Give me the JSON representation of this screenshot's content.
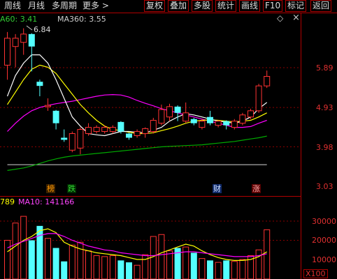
{
  "toolbar": {
    "left_tabs": [
      "周线",
      "月线",
      "多周期",
      "更多 >"
    ],
    "right_tabs": [
      "复权",
      "叠加",
      "多股",
      "统计",
      "画线",
      "F10",
      "标记",
      "返回"
    ]
  },
  "main_legend": {
    "ma60": "A60: 3.41",
    "ma360": "MA360: 3.55",
    "diamond_icon": "diamond-icon",
    "close_icon": "close-x-icon"
  },
  "volume_legend": {
    "vol": "789",
    "ma10": "MA10: 141166"
  },
  "price_axis": [
    "5.89",
    "4.93",
    "3.98",
    "3.03"
  ],
  "volume_axis": [
    "30000",
    "20000",
    "10000"
  ],
  "volume_unit": "X100",
  "peak_label": "6.84",
  "event_tags": [
    {
      "text": "榜",
      "color": "#ff9900",
      "bg": "#3a2000"
    },
    {
      "text": "跌",
      "color": "#33dd33",
      "bg": "#002a00"
    },
    {
      "text": "财",
      "color": "#cfe0ff",
      "bg": "#102a6a"
    },
    {
      "text": "涨",
      "color": "#ffaaaa",
      "bg": "#5a0000"
    }
  ],
  "colors": {
    "up": "#ff3232",
    "down": "#54ffff",
    "ma5": "#ffffff",
    "ma10": "#ffff00",
    "ma20": "#ff00ff",
    "ma60": "#00aa00",
    "ma360": "#aaaaaa",
    "grid": "#8a0000"
  },
  "chart_data": {
    "type": "candlestick",
    "price_ticks": [
      5.89,
      4.93,
      3.98,
      3.03
    ],
    "volume_ticks": [
      30000,
      20000,
      10000
    ],
    "candles": [
      {
        "o": 5.95,
        "c": 6.6,
        "h": 6.75,
        "l": 5.6,
        "v": 20000
      },
      {
        "o": 6.4,
        "c": 6.6,
        "h": 6.7,
        "l": 5.9,
        "v": 29000
      },
      {
        "o": 6.5,
        "c": 6.7,
        "h": 6.84,
        "l": 6.2,
        "v": 32500
      },
      {
        "o": 6.7,
        "c": 6.4,
        "h": 6.72,
        "l": 5.8,
        "v": 20000
      },
      {
        "o": 5.55,
        "c": 5.45,
        "h": 5.6,
        "l": 5.2,
        "v": 27500
      },
      {
        "o": 4.95,
        "c": 4.98,
        "h": 5.15,
        "l": 4.85,
        "v": 21000
      },
      {
        "o": 4.85,
        "c": 4.55,
        "h": 4.87,
        "l": 4.4,
        "v": 16000
      },
      {
        "o": 4.2,
        "c": 4.15,
        "h": 4.4,
        "l": 4.1,
        "v": 9000
      },
      {
        "o": 3.9,
        "c": 4.3,
        "h": 4.35,
        "l": 3.85,
        "v": 17500
      },
      {
        "o": 3.95,
        "c": 4.4,
        "h": 4.45,
        "l": 3.8,
        "v": 19000
      },
      {
        "o": 4.3,
        "c": 4.45,
        "h": 4.55,
        "l": 4.25,
        "v": 14500
      },
      {
        "o": 4.35,
        "c": 4.45,
        "h": 4.5,
        "l": 4.3,
        "v": 12000
      },
      {
        "o": 4.35,
        "c": 4.45,
        "h": 4.5,
        "l": 4.3,
        "v": 11500
      },
      {
        "o": 4.35,
        "c": 4.45,
        "h": 4.5,
        "l": 4.3,
        "v": 12000
      },
      {
        "o": 4.58,
        "c": 4.35,
        "h": 4.6,
        "l": 4.3,
        "v": 9500
      },
      {
        "o": 4.3,
        "c": 4.2,
        "h": 4.32,
        "l": 4.15,
        "v": 8500
      },
      {
        "o": 4.25,
        "c": 4.35,
        "h": 4.4,
        "l": 4.2,
        "v": 7000
      },
      {
        "o": 4.3,
        "c": 4.42,
        "h": 4.45,
        "l": 4.2,
        "v": 12500
      },
      {
        "o": 4.35,
        "c": 4.62,
        "h": 4.68,
        "l": 4.3,
        "v": 22000
      },
      {
        "o": 4.55,
        "c": 4.88,
        "h": 5.0,
        "l": 4.5,
        "v": 23000
      },
      {
        "o": 4.7,
        "c": 4.95,
        "h": 5.02,
        "l": 4.6,
        "v": 14500
      },
      {
        "o": 4.95,
        "c": 4.8,
        "h": 4.98,
        "l": 4.6,
        "v": 16000
      },
      {
        "o": 4.6,
        "c": 4.8,
        "h": 5.05,
        "l": 4.55,
        "v": 16500
      },
      {
        "o": 4.65,
        "c": 4.55,
        "h": 4.68,
        "l": 4.5,
        "v": 13500
      },
      {
        "o": 4.45,
        "c": 4.6,
        "h": 4.65,
        "l": 4.4,
        "v": 10500
      },
      {
        "o": 4.7,
        "c": 4.55,
        "h": 4.85,
        "l": 4.5,
        "v": 9500
      },
      {
        "o": 4.5,
        "c": 4.6,
        "h": 4.62,
        "l": 4.45,
        "v": 8500
      },
      {
        "o": 4.6,
        "c": 4.5,
        "h": 4.62,
        "l": 4.4,
        "v": 9500
      },
      {
        "o": 4.45,
        "c": 4.6,
        "h": 4.65,
        "l": 4.4,
        "v": 9000
      },
      {
        "o": 4.55,
        "c": 4.75,
        "h": 4.8,
        "l": 4.5,
        "v": 10000
      },
      {
        "o": 4.7,
        "c": 4.85,
        "h": 4.9,
        "l": 4.65,
        "v": 12000
      },
      {
        "o": 4.85,
        "c": 5.45,
        "h": 5.5,
        "l": 4.8,
        "v": 15000
      },
      {
        "o": 5.45,
        "c": 5.68,
        "h": 5.82,
        "l": 5.4,
        "v": 25500
      }
    ],
    "ma5": [
      5.2,
      5.7,
      6.0,
      6.2,
      6.2,
      6.0,
      5.6,
      5.15,
      4.7,
      4.48,
      4.3,
      4.27,
      4.25,
      4.3,
      4.35,
      4.35,
      4.33,
      4.32,
      4.38,
      4.45,
      4.6,
      4.7,
      4.78,
      4.75,
      4.7,
      4.65,
      4.6,
      4.58,
      4.55,
      4.6,
      4.7,
      4.9,
      5.05
    ],
    "ma10": [
      5.0,
      5.3,
      5.6,
      5.85,
      5.95,
      5.9,
      5.75,
      5.5,
      5.25,
      5.0,
      4.8,
      4.62,
      4.48,
      4.4,
      4.37,
      4.33,
      4.3,
      4.3,
      4.32,
      4.37,
      4.42,
      4.48,
      4.55,
      4.6,
      4.62,
      4.63,
      4.62,
      4.6,
      4.58,
      4.6,
      4.62,
      4.7,
      4.8
    ],
    "ma20": [
      4.35,
      4.55,
      4.72,
      4.85,
      4.93,
      4.98,
      5.02,
      5.05,
      5.08,
      5.12,
      5.16,
      5.2,
      5.23,
      5.24,
      5.23,
      5.18,
      5.1,
      5.03,
      4.97,
      4.9,
      4.85,
      4.8,
      4.75,
      4.7,
      4.65,
      4.6,
      4.55,
      4.5,
      4.45,
      4.45,
      4.47,
      4.55,
      4.62
    ],
    "ma60": [
      3.41,
      3.44,
      3.47,
      3.52,
      3.58,
      3.64,
      3.69,
      3.73,
      3.76,
      3.78,
      3.8,
      3.82,
      3.84,
      3.86,
      3.88,
      3.9,
      3.92,
      3.94,
      3.96,
      3.98,
      3.99,
      4.0,
      4.01,
      4.02,
      4.03,
      4.05,
      4.07,
      4.09,
      4.11,
      4.14,
      4.17,
      4.2,
      4.24
    ],
    "ma360": [
      3.55,
      3.55,
      3.55,
      3.55,
      3.55,
      3.55,
      3.55,
      3.55,
      3.55,
      3.55,
      3.55,
      3.55,
      3.55,
      3.55,
      3.55,
      3.55,
      3.55,
      3.55,
      3.55,
      3.55,
      3.55,
      3.55,
      3.55,
      3.55,
      3.55,
      3.55,
      3.55,
      3.55,
      3.55,
      3.55,
      3.55,
      3.55,
      3.55
    ],
    "vol_ma5": [
      14000,
      17000,
      20000,
      22000,
      25000,
      26000,
      24000,
      19000,
      17000,
      15500,
      14500,
      13500,
      13000,
      12500,
      12000,
      11000,
      10000,
      10000,
      11500,
      13500,
      15000,
      16500,
      18000,
      17000,
      14500,
      12500,
      11000,
      10000,
      9500,
      9500,
      10000,
      11500,
      14000
    ],
    "vol_ma10": [
      16000,
      18000,
      19500,
      21000,
      22500,
      23500,
      23500,
      22000,
      20000,
      18500,
      17000,
      16000,
      15000,
      14500,
      13500,
      13000,
      12500,
      12000,
      12000,
      12500,
      13000,
      13500,
      14000,
      14000,
      13500,
      13000,
      12500,
      12000,
      11500,
      11500,
      11500,
      12000,
      13000
    ]
  }
}
